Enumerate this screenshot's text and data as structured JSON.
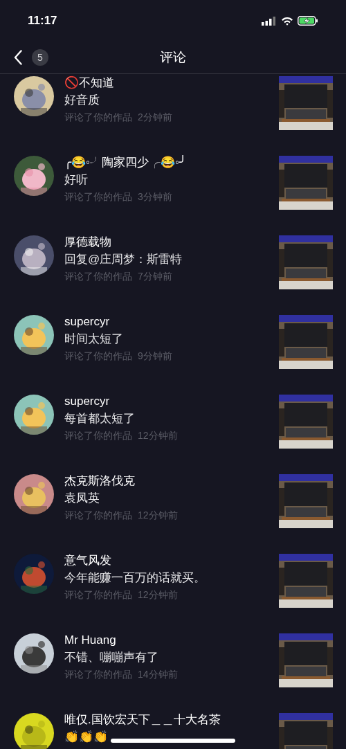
{
  "status_bar": {
    "time": "11:17"
  },
  "header": {
    "back_count": "5",
    "title": "评论"
  },
  "comments": [
    {
      "name": "🚫不知道",
      "text": "好音质",
      "action": "评论了你的作品",
      "time": "2分钟前"
    },
    {
      "name": "╭😂◦╯陶家四少╭😂◦╯",
      "text": "好听",
      "action": "评论了你的作品",
      "time": "3分钟前"
    },
    {
      "name": "厚德载物",
      "text": "回复@庄周梦：斯雷特",
      "action": "评论了你的作品",
      "time": "7分钟前"
    },
    {
      "name": "supercyr",
      "text": "时间太短了",
      "action": "评论了你的作品",
      "time": "9分钟前"
    },
    {
      "name": "supercyr",
      "text": "每首都太短了",
      "action": "评论了你的作品",
      "time": "12分钟前"
    },
    {
      "name": "杰克斯洛伐克",
      "text": "袁凤英",
      "action": "评论了你的作品",
      "time": "12分钟前"
    },
    {
      "name": "意气风发",
      "text": "今年能赚一百万的话就买。",
      "action": "评论了你的作品",
      "time": "12分钟前"
    },
    {
      "name": "Mr Huang",
      "text": "不错、嘣嘣声有了",
      "action": "评论了你的作品",
      "time": "14分钟前"
    },
    {
      "name": "唯仅.国饮宏天下＿＿十大名茶",
      "text": "👏👏👏"
    }
  ]
}
